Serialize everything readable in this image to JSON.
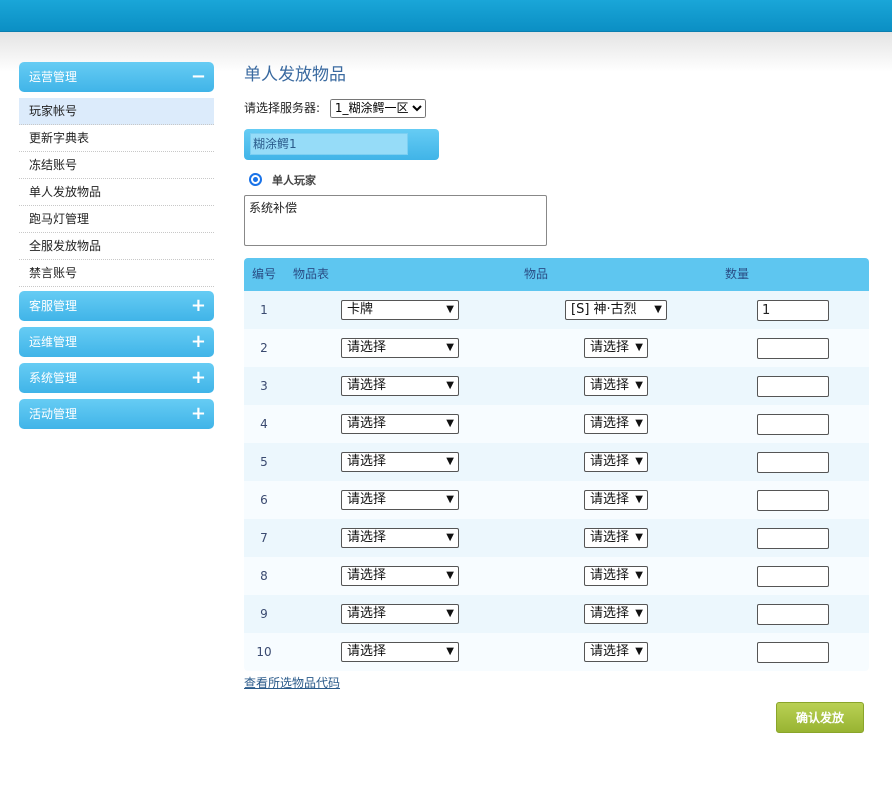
{
  "sidebar": {
    "groups": [
      {
        "label": "运营管理",
        "toggle": "−",
        "expanded": true,
        "items": [
          "玩家帐号",
          "更新字典表",
          "冻结账号",
          "单人发放物品",
          "跑马灯管理",
          "全服发放物品",
          "禁言账号"
        ]
      },
      {
        "label": "客服管理",
        "toggle": "+"
      },
      {
        "label": "运维管理",
        "toggle": "+"
      },
      {
        "label": "系统管理",
        "toggle": "+"
      },
      {
        "label": "活动管理",
        "toggle": "+"
      }
    ]
  },
  "main": {
    "title": "单人发放物品",
    "server_label": "请选择服务器:",
    "server_selected": "1_糊涂鳄一区",
    "player_name": "糊涂鳄1",
    "mode_label": "单人玩家",
    "reason": "系统补偿",
    "table": {
      "headers": [
        "编号",
        "物品表",
        "物品",
        "数量"
      ],
      "rows": [
        {
          "no": "1",
          "table": "卡牌",
          "item": "[S] 神·古烈",
          "qty": "1"
        },
        {
          "no": "2",
          "table": "请选择",
          "item": "请选择",
          "qty": ""
        },
        {
          "no": "3",
          "table": "请选择",
          "item": "请选择",
          "qty": ""
        },
        {
          "no": "4",
          "table": "请选择",
          "item": "请选择",
          "qty": ""
        },
        {
          "no": "5",
          "table": "请选择",
          "item": "请选择",
          "qty": ""
        },
        {
          "no": "6",
          "table": "请选择",
          "item": "请选择",
          "qty": ""
        },
        {
          "no": "7",
          "table": "请选择",
          "item": "请选择",
          "qty": ""
        },
        {
          "no": "8",
          "table": "请选择",
          "item": "请选择",
          "qty": ""
        },
        {
          "no": "9",
          "table": "请选择",
          "item": "请选择",
          "qty": ""
        },
        {
          "no": "10",
          "table": "请选择",
          "item": "请选择",
          "qty": ""
        }
      ]
    },
    "view_code_link": "查看所选物品代码",
    "submit_label": "确认发放"
  }
}
